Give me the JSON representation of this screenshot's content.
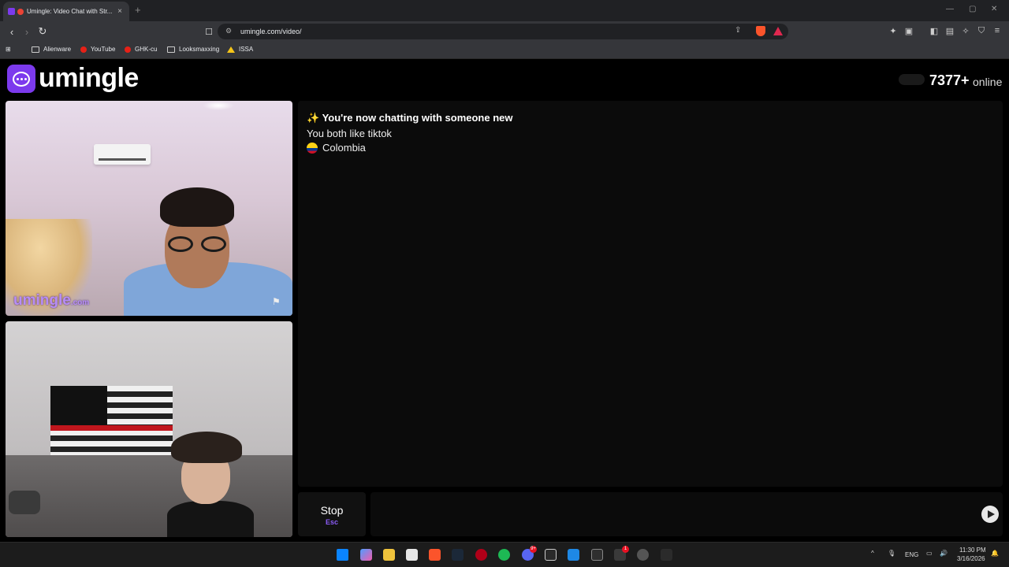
{
  "browser": {
    "tab_title": "Umingle: Video Chat with Str...",
    "tab_close": "×",
    "new_tab": "+",
    "url": "umingle.com/video/",
    "nav": {
      "back": "‹",
      "forward": "›",
      "reload": "↻"
    },
    "window_controls": {
      "minimize": "—",
      "maximize": "▢",
      "close": "✕"
    },
    "bookmarks": [
      {
        "label": "Alienware",
        "icon": "folder-icon"
      },
      {
        "label": "YouTube",
        "icon": "youtube-icon"
      },
      {
        "label": "GHK-cu",
        "icon": "youtube-icon"
      },
      {
        "label": "Looksmaxxing",
        "icon": "folder-icon"
      },
      {
        "label": "ISSA",
        "icon": "issa-icon"
      }
    ]
  },
  "site": {
    "logo_text": "umingle",
    "online_count": "7377+",
    "online_label": "online"
  },
  "video": {
    "stranger_watermark": "umingle",
    "stranger_watermark_suffix": ".com"
  },
  "chat": {
    "status_title": "✨ You're now chatting with someone new",
    "common_interest": "You both like tiktok",
    "country": "Colombia",
    "input_value": "",
    "stop_label": "Stop",
    "stop_shortcut": "Esc"
  },
  "taskbar": {
    "time": "11:30 PM",
    "date": "3/16/2026",
    "language": "ENG",
    "badges": {
      "discord": "9+",
      "notifications": "1"
    }
  },
  "colors": {
    "brand": "#7c3aed",
    "accent_text": "#8b5cf6",
    "background": "#000000"
  }
}
